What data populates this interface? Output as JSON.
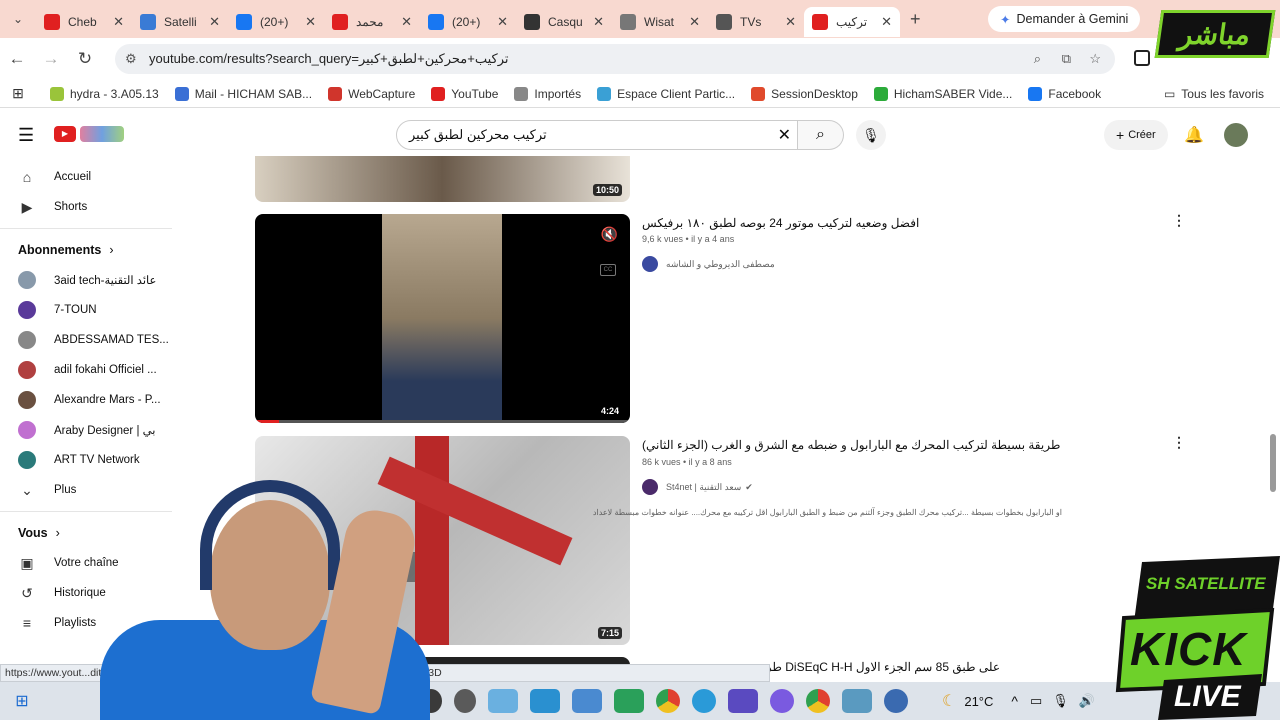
{
  "browser": {
    "tabs": [
      {
        "title": "Cheb",
        "icon": "youtube-icon",
        "color": "#e02020"
      },
      {
        "title": "Satelli",
        "icon": "globe-icon",
        "color": "#3a7bd5"
      },
      {
        "title": "(20+)",
        "icon": "facebook-icon",
        "color": "#1877f2"
      },
      {
        "title": "محمد",
        "icon": "youtube-icon",
        "color": "#e02020"
      },
      {
        "title": "(20+)",
        "icon": "facebook-icon",
        "color": "#1877f2"
      },
      {
        "title": "Casqu",
        "icon": "pc-icon",
        "color": "#333333"
      },
      {
        "title": "Wisat",
        "icon": "cart-icon",
        "color": "#777777"
      },
      {
        "title": "TVs",
        "icon": "flag-icon",
        "color": "#555555"
      },
      {
        "title": "تركيب",
        "icon": "youtube-icon",
        "color": "#e02020",
        "active": true
      }
    ],
    "gemini_label": "Demander à Gemini",
    "url": "youtube.com/results?search_query=تركيب+محركين+لطبق+كبير",
    "bookmarks": [
      {
        "label": "hydra - 3.A05.13",
        "color": "#9ac43a"
      },
      {
        "label": "Mail - HICHAM SAB...",
        "color": "#3a6fd5"
      },
      {
        "label": "WebCapture",
        "color": "#d0352c"
      },
      {
        "label": "YouTube",
        "color": "#e02020"
      },
      {
        "label": "Importés",
        "color": "#888888"
      },
      {
        "label": "Espace Client Partic...",
        "color": "#3aa0d5"
      },
      {
        "label": "SessionDesktop",
        "color": "#e04a2c"
      },
      {
        "label": "HichamSABER Vide...",
        "color": "#2cab3a"
      },
      {
        "label": "Facebook",
        "color": "#1877f2"
      }
    ],
    "all_favorites": "Tous les favoris",
    "status_url": "https://www.yout...dit2LHZg9mK2YYg2YTYt9io2Ylg2YPYqNmK2LHSBwkJEwwBhyohjO8%3D"
  },
  "youtube": {
    "search_value": "تركيب محركين لطبق كبير",
    "create_label": "Créer",
    "sidebar": {
      "main": [
        {
          "label": "Accueil",
          "icon": "home-icon"
        },
        {
          "label": "Shorts",
          "icon": "shorts-icon"
        }
      ],
      "subs_heading": "Abonnements",
      "subs": [
        {
          "label": "3aid tech-عائد التقنية",
          "color": "#8899aa"
        },
        {
          "label": "7-TOUN",
          "color": "#5a3a9a"
        },
        {
          "label": "ABDESSAMAD TES...",
          "color": "#888888"
        },
        {
          "label": "adil fokahi Officiel ...",
          "color": "#b04040"
        },
        {
          "label": "Alexandre Mars - P...",
          "color": "#6a5040"
        },
        {
          "label": "Araby Designer | بي",
          "color": "#c070d0"
        },
        {
          "label": "ART TV Network",
          "color": "#2a7a7a"
        }
      ],
      "more_label": "Plus",
      "you_heading": "Vous",
      "you": [
        {
          "label": "Votre chaîne",
          "icon": "channel-icon"
        },
        {
          "label": "Historique",
          "icon": "history-icon"
        },
        {
          "label": "Playlists",
          "icon": "playlists-icon"
        }
      ]
    },
    "videos": [
      {
        "duration": "10:50"
      },
      {
        "title": "افضل وضعيه لتركيب موتور 24 بوصه لطبق ١٨٠ برفيكس",
        "meta": "9,6 k vues • il y a 4 ans",
        "channel": "مصطفى الديروطي و الشاشه",
        "duration": "4:24"
      },
      {
        "title": "طريقة بسيطة لتركيب المحرك مع البارابول و ضبطه مع الشرق و الغرب (الجزء الثاني)",
        "meta": "86 k vues • il y a 8 ans",
        "channel": "St4net | سعد التقنية",
        "desc": "او البارابول بخطوات بسيطة ...تركيب محرك الطبق وجزء آلتنم من ضبط و الطبق البارابول اقل تركيبه مع محرك.... عنوانه خطوات مبسطة لاعداد",
        "duration": "7:15"
      },
      {
        "title": "على طبق 85 سم الجزء الاول DiSEqC H-H طريقة"
      }
    ]
  },
  "overlays": {
    "mubashir": "مباشر",
    "brand_top": "SH SATELLITE",
    "brand_kick": "KICK",
    "brand_live": "LIVE"
  },
  "taskbar": {
    "weather": "21°C"
  }
}
